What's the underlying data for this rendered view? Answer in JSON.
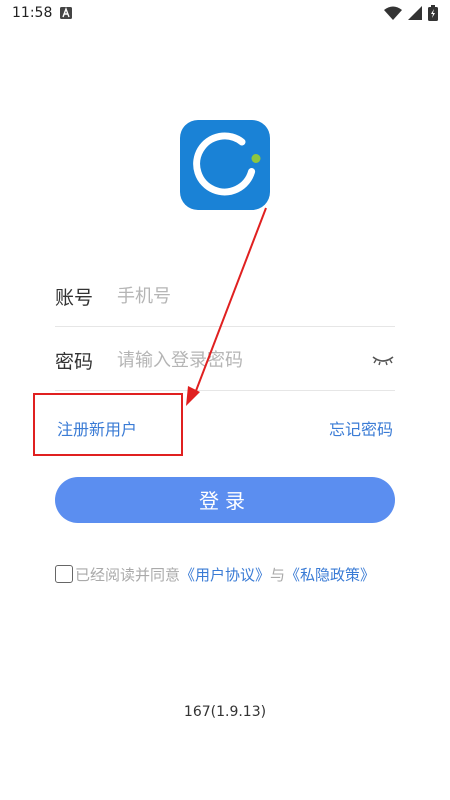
{
  "status_bar": {
    "time": "11:58",
    "notification_icon": "a-square-icon",
    "icons": [
      "wifi-icon",
      "signal-icon",
      "battery-icon"
    ]
  },
  "app": {
    "logo_icon": "ring-logo-icon",
    "colors": {
      "logo_bg": "#1a82d6",
      "logo_dot": "#8dc63f",
      "primary_button": "#5b8ef0",
      "link": "#3a7bd5",
      "annotation": "#e02020"
    }
  },
  "form": {
    "account_label": "账号",
    "account_placeholder": "手机号",
    "password_label": "密码",
    "password_placeholder": "请输入登录密码",
    "password_toggle_icon": "eye-closed-icon",
    "register_link": "注册新用户",
    "forgot_link": "忘记密码",
    "login_button": "登录"
  },
  "agreement": {
    "prefix": "已经阅读并同意",
    "user_agreement": "《用户协议》",
    "conjunction": "与",
    "privacy_policy": "《私隐政策》"
  },
  "version": "167(1.9.13)"
}
